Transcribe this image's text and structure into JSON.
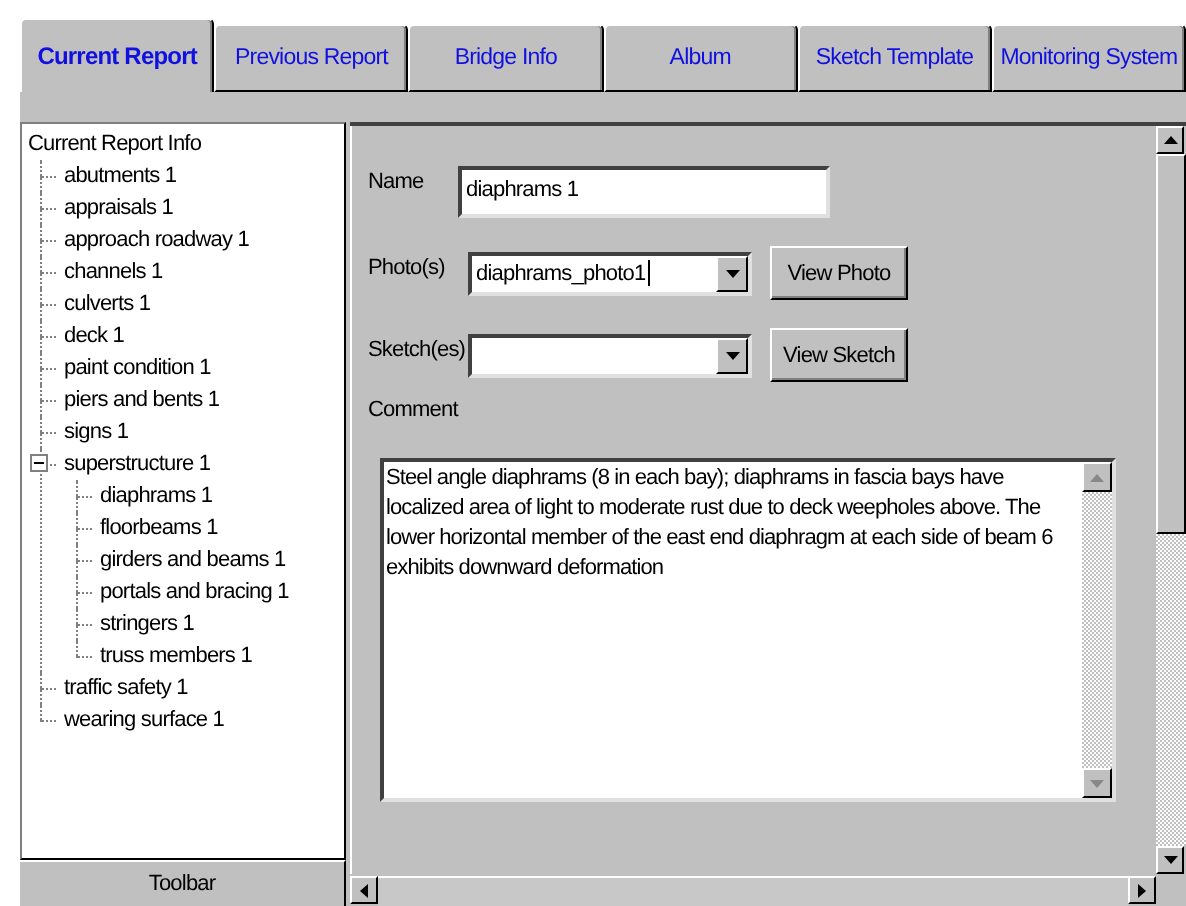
{
  "tabs": [
    {
      "label": "Current Report",
      "selected": true
    },
    {
      "label": "Previous Report",
      "selected": false
    },
    {
      "label": "Bridge Info",
      "selected": false
    },
    {
      "label": "Album",
      "selected": false
    },
    {
      "label": "Sketch Template",
      "selected": false
    },
    {
      "label": "Monitoring System",
      "selected": false
    }
  ],
  "tree": {
    "label": "Current Report Info",
    "children": [
      {
        "label": "abutments 1"
      },
      {
        "label": "appraisals 1"
      },
      {
        "label": "approach roadway 1"
      },
      {
        "label": "channels 1"
      },
      {
        "label": "culverts 1"
      },
      {
        "label": "deck 1"
      },
      {
        "label": "paint condition 1"
      },
      {
        "label": "piers and bents 1"
      },
      {
        "label": "signs 1"
      },
      {
        "label": "superstructure 1",
        "expanded": true,
        "children": [
          {
            "label": "diaphrams 1"
          },
          {
            "label": "floorbeams 1"
          },
          {
            "label": "girders and beams 1"
          },
          {
            "label": "portals and bracing 1"
          },
          {
            "label": "stringers 1"
          },
          {
            "label": "truss members 1"
          }
        ]
      },
      {
        "label": "traffic safety 1"
      },
      {
        "label": "wearing surface 1"
      }
    ]
  },
  "toolbar": {
    "label": "Toolbar"
  },
  "form": {
    "name": {
      "label": "Name",
      "value": "diaphrams 1"
    },
    "photos": {
      "label": "Photo(s)",
      "value": "diaphrams_photo1",
      "button": "View Photo"
    },
    "sketches": {
      "label": "Sketch(es)",
      "button": "View Sketch"
    },
    "comment": {
      "label": "Comment",
      "value": "Steel angle diaphrams (8 in each bay); diaphrams in fascia bays have localized area of light to moderate rust due to deck weepholes above. The lower horizontal member of the east end diaphragm at each side of beam 6 exhibits downward deformation"
    }
  }
}
